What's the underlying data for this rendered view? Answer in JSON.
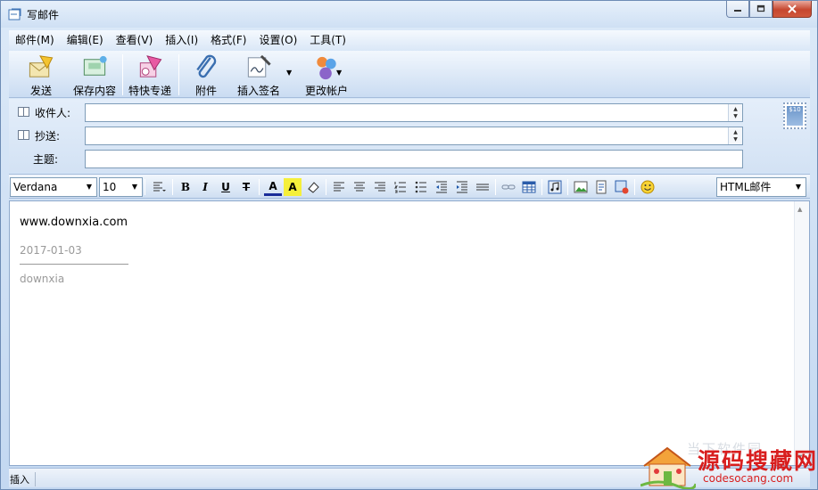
{
  "window": {
    "title": "写邮件"
  },
  "menubar": {
    "items": [
      "邮件(M)",
      "编辑(E)",
      "查看(V)",
      "插入(I)",
      "格式(F)",
      "设置(O)",
      "工具(T)"
    ]
  },
  "toolbar": {
    "send_label": "发送",
    "save_label": "保存内容",
    "express_label": "特快专递",
    "attach_label": "附件",
    "signature_label": "插入签名",
    "account_label": "更改帐户"
  },
  "address": {
    "to_label": "收件人:",
    "to_value": "",
    "cc_label": "抄送:",
    "cc_value": "",
    "subject_label": "主题:",
    "subject_value": "",
    "stamp_text": "$10"
  },
  "format": {
    "font": "Verdana",
    "size": "10",
    "mode": "HTML邮件",
    "bold": "B",
    "italic": "I",
    "underline": "U",
    "strike": "T",
    "font_color": "A",
    "highlight": "A"
  },
  "editor": {
    "line1": "www.downxia.com",
    "line2": "2017-01-03",
    "line3": "downxia"
  },
  "status": {
    "mode": "插入"
  },
  "watermark": {
    "faint_text": "当下软件园",
    "brand": "源码搜藏网",
    "url": "codesocang.com"
  },
  "colors": {
    "accent": "#c3d8f1",
    "close": "#c6472f",
    "brand_red": "#d81e1e"
  }
}
